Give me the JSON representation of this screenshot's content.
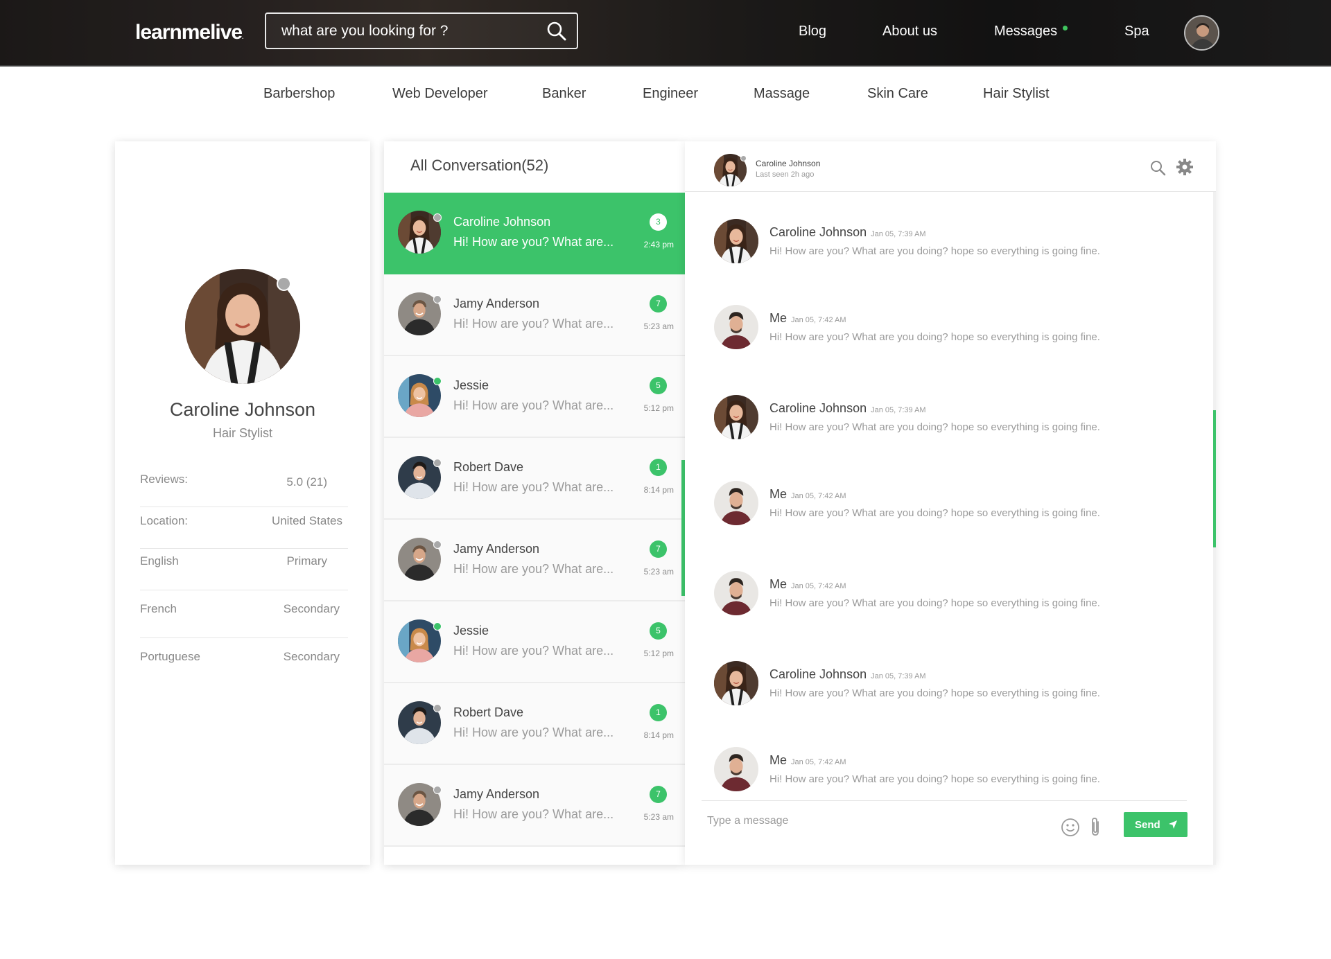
{
  "header": {
    "logo": "learnmelive",
    "logo_mark": ".",
    "search_placeholder": "what are you looking for ?",
    "nav": {
      "blog": "Blog",
      "about": "About us",
      "messages": "Messages",
      "spa": "Spa"
    }
  },
  "categories": [
    "Barbershop",
    "Web Developer",
    "Banker",
    "Engineer",
    "Massage",
    "Skin Care",
    "Hair Stylist"
  ],
  "profile": {
    "name": "Caroline Johnson",
    "role": "Hair Stylist",
    "stats": [
      {
        "label": "Reviews:",
        "value": "5.0 (21)"
      },
      {
        "label": "Location:",
        "value": "United States"
      },
      {
        "label": "English",
        "value": "Primary"
      },
      {
        "label": "French",
        "value": "Secondary"
      },
      {
        "label": "Portuguese",
        "value": "Secondary"
      }
    ]
  },
  "conversations": {
    "title": "All Conversation(52)",
    "items": [
      {
        "name": "Caroline Johnson",
        "preview": "Hi! How are you? What are...",
        "count": "3",
        "time": "2:43 pm",
        "online": false
      },
      {
        "name": "Jamy Anderson",
        "preview": "Hi! How are you? What are...",
        "count": "7",
        "time": "5:23 am",
        "online": false
      },
      {
        "name": "Jessie",
        "preview": "Hi! How are you? What are...",
        "count": "5",
        "time": "5:12 pm",
        "online": true
      },
      {
        "name": "Robert Dave",
        "preview": "Hi! How are you? What are...",
        "count": "1",
        "time": "8:14 pm",
        "online": false
      },
      {
        "name": "Jamy Anderson",
        "preview": "Hi! How are you? What are...",
        "count": "7",
        "time": "5:23 am",
        "online": false
      },
      {
        "name": "Jessie",
        "preview": "Hi! How are you? What are...",
        "count": "5",
        "time": "5:12 pm",
        "online": true
      },
      {
        "name": "Robert Dave",
        "preview": "Hi! How are you? What are...",
        "count": "1",
        "time": "8:14 pm",
        "online": false
      },
      {
        "name": "Jamy Anderson",
        "preview": "Hi! How are you? What are...",
        "count": "7",
        "time": "5:23 am",
        "online": false
      }
    ]
  },
  "chat": {
    "contact_name": "Caroline Johnson",
    "last_seen": "Last seen 2h ago",
    "messages": [
      {
        "sender": "Caroline Johnson",
        "time": "Jan 05, 7:39 AM",
        "text": "Hi! How are you? What are you doing? hope so everything is going fine.",
        "who": "her"
      },
      {
        "sender": "Me",
        "time": "Jan 05, 7:42 AM",
        "text": "Hi! How are you? What are you doing? hope so everything is going fine.",
        "who": "me"
      },
      {
        "sender": "Caroline Johnson",
        "time": "Jan 05, 7:39 AM",
        "text": "Hi! How are you? What are you doing? hope so everything is going fine.",
        "who": "her"
      },
      {
        "sender": "Me",
        "time": "Jan 05, 7:42 AM",
        "text": "Hi! How are you? What are you doing? hope so everything is going fine.",
        "who": "me"
      },
      {
        "sender": "Me",
        "time": "Jan 05, 7:42 AM",
        "text": "Hi! How are you? What are you doing? hope so everything is going fine.",
        "who": "me"
      },
      {
        "sender": "Caroline Johnson",
        "time": "Jan 05, 7:39 AM",
        "text": "Hi! How are you? What are you doing? hope so everything is going fine.",
        "who": "her"
      },
      {
        "sender": "Me",
        "time": "Jan 05, 7:42 AM",
        "text": "Hi! How are you? What are you doing? hope so everything is going fine.",
        "who": "me"
      }
    ],
    "input_placeholder": "Type a message",
    "send_label": "Send"
  },
  "colors": {
    "accent": "#3cc36a",
    "offline": "#a9a9a9",
    "text": "#444444",
    "muted": "#9a9a9a"
  }
}
